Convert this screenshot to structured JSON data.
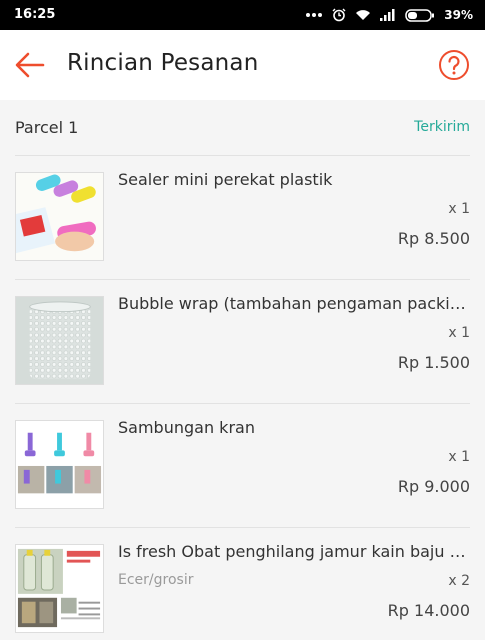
{
  "status_bar": {
    "time": "16:25",
    "battery": "39%"
  },
  "header": {
    "title": "Rincian Pesanan"
  },
  "parcel": {
    "title": "Parcel 1",
    "status": "Terkirim"
  },
  "items": [
    {
      "name": "Sealer mini perekat plastik",
      "variant": "",
      "qty": "x 1",
      "price": "Rp 8.500"
    },
    {
      "name": "Bubble wrap (tambahan pengaman packing)",
      "variant": "",
      "qty": "x 1",
      "price": "Rp 1.500"
    },
    {
      "name": "Sambungan kran",
      "variant": "",
      "qty": "x 1",
      "price": "Rp 9.000"
    },
    {
      "name": "Is fresh Obat penghilang jamur kain baju mu...",
      "variant": "Ecer/grosir",
      "qty": "x 2",
      "price": "Rp 14.000"
    }
  ],
  "colors": {
    "accent": "#ee4d2d",
    "status": "#26aa99"
  },
  "icons": [
    "back-arrow-icon",
    "help-icon",
    "signal-dots-icon",
    "alarm-icon",
    "wifi-icon",
    "cellular-icon",
    "battery-icon"
  ]
}
